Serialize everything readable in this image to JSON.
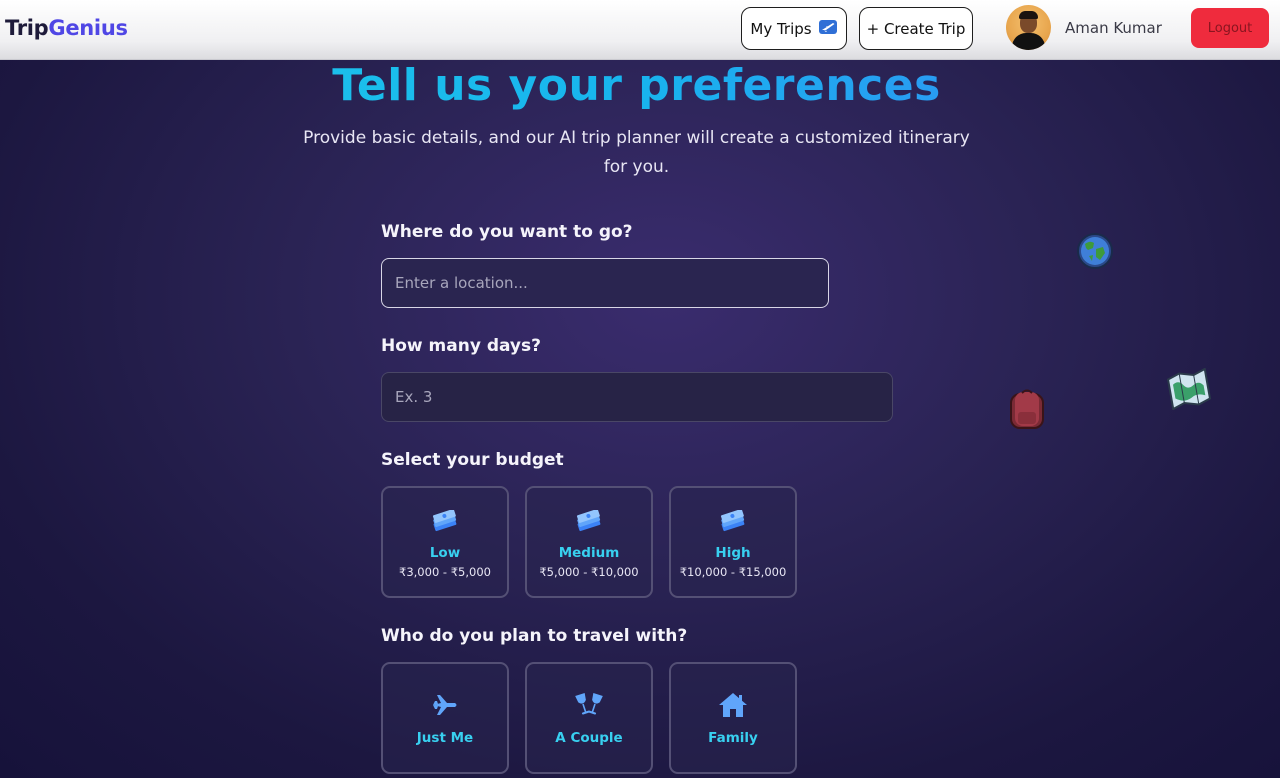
{
  "header": {
    "logo_part1": "Trip",
    "logo_part2": "Genius",
    "my_trips_label": "My Trips",
    "my_trips_emoji": "✈",
    "create_trip_label": "+ Create Trip",
    "user_name": "Aman Kumar",
    "logout_label": "Logout"
  },
  "main": {
    "title": "Tell us your preferences",
    "subtitle": "Provide basic details, and our AI trip planner will create a customized itinerary for you.",
    "destination": {
      "label": "Where do you want to go?",
      "placeholder": "Enter a location..."
    },
    "days": {
      "label": "How many days?",
      "placeholder": "Ex. 3"
    },
    "budget": {
      "label": "Select your budget",
      "options": [
        {
          "name": "Low",
          "range": "₹3,000 - ₹5,000",
          "icon": "money-stack-icon"
        },
        {
          "name": "Medium",
          "range": "₹5,000 - ₹10,000",
          "icon": "money-stack-icon"
        },
        {
          "name": "High",
          "range": "₹10,000 - ₹15,000",
          "icon": "money-stack-icon"
        }
      ]
    },
    "travelers": {
      "label": "Who do you plan to travel with?",
      "options": [
        {
          "name": "Just Me",
          "icon": "airplane-icon"
        },
        {
          "name": "A Couple",
          "icon": "cheers-glasses-icon"
        },
        {
          "name": "Family",
          "icon": "house-icon"
        }
      ]
    }
  },
  "decorations": [
    "globe-icon",
    "backpack-icon",
    "map-icon"
  ],
  "colors": {
    "accent_cyan": "#38d0f0",
    "brand_indigo": "#4f46e5",
    "logout_red": "#ef2b3d",
    "icon_blue": "#60a5fa"
  }
}
